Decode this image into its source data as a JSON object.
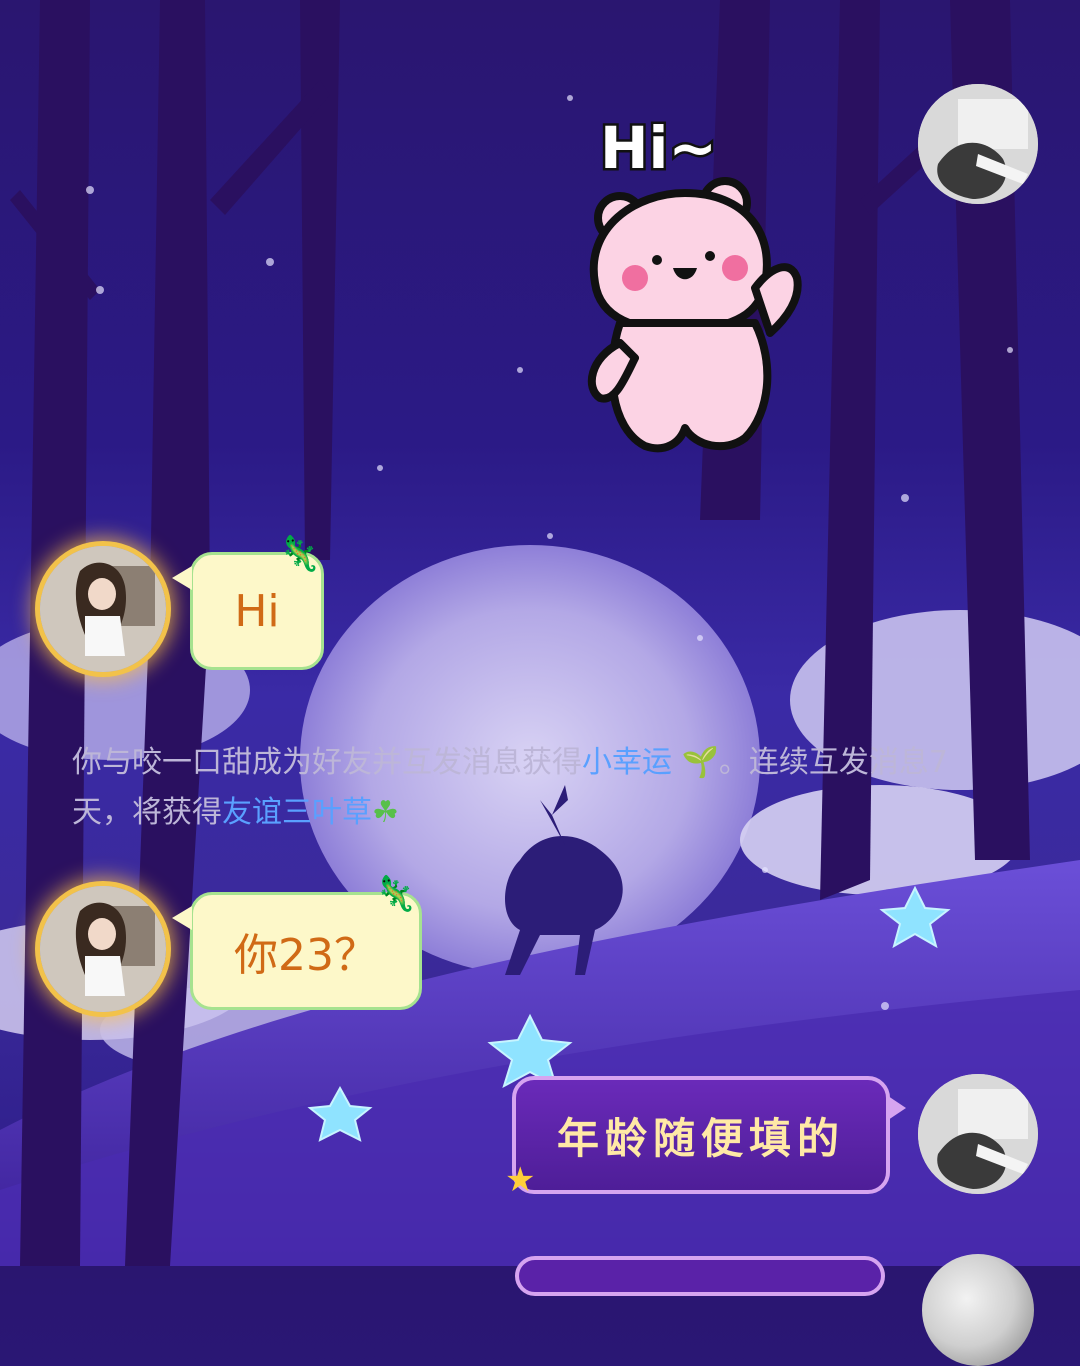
{
  "colors": {
    "accent_link": "#5aa0ff",
    "system_text": "#bdb6d8",
    "left_bubble_bg": "#fdf8c9",
    "left_bubble_text": "#d06a16",
    "right_bubble_bg": "#5a22a8",
    "right_bubble_text": "#ffe9a6"
  },
  "messages": [
    {
      "side": "right",
      "type": "sticker",
      "sticker_text": "Hi~",
      "sticker_name": "pink-bear-waving-sticker"
    },
    {
      "side": "left",
      "type": "text",
      "text": "Hi"
    },
    {
      "side": "left",
      "type": "text",
      "text": "你23？"
    },
    {
      "side": "right",
      "type": "text",
      "text": "年龄随便填的"
    }
  ],
  "system_notice": {
    "prefix": "你与咬一口甜成为好友并互发消息获得",
    "link1": "小幸运",
    "link1_icon": "sprout-icon",
    "middle": "。连续互发消息7天，将获得",
    "link2": "友谊三叶草",
    "link2_icon": "clover-icon"
  }
}
